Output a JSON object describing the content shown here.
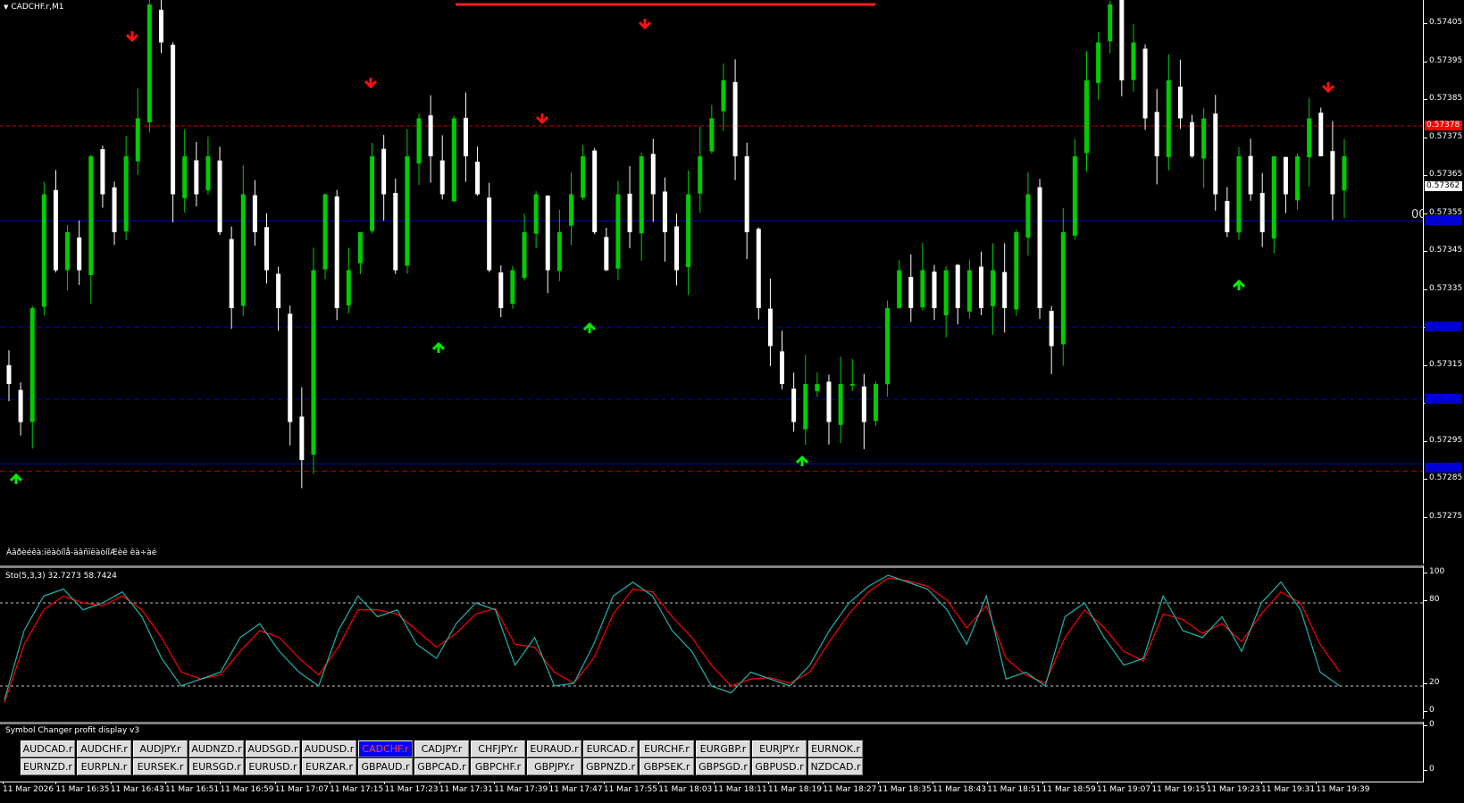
{
  "window": {
    "title": "CADCHF.r,M1"
  },
  "main": {
    "footer_note": "Àâðèéêà:ïëàòíîå-äâñïëàòíîÆèë êà÷àé",
    "spread_readout": "00"
  },
  "price_axis": {
    "ticks": [
      "0.57405",
      "0.57395",
      "0.57385",
      "0.57375",
      "0.57365",
      "0.57355",
      "0.57345",
      "0.57335",
      "0.57325",
      "0.57315",
      "0.57305",
      "0.57295",
      "0.57285",
      "0.57275"
    ],
    "tags": [
      {
        "value": "0.57378",
        "bg": "#ff0000",
        "color": "#ffffff"
      },
      {
        "value": "0.57362",
        "bg": "#ffffff",
        "color": "#000000"
      },
      {
        "value": "0.57353",
        "bg": "#0000cc",
        "color": "#0000ff"
      },
      {
        "value": "0.57325",
        "bg": "#0000cc",
        "color": "#0000ff"
      },
      {
        "value": "0.57306",
        "bg": "#0000cc",
        "color": "#0000ff"
      },
      {
        "value": "0.57288",
        "bg": "#0000cc",
        "color": "#0000ff"
      }
    ]
  },
  "colors": {
    "bull": "#00cc00",
    "bear": "#ffffff",
    "up_arrow": "#00ee00",
    "down_arrow": "#ff1010",
    "res_line": "#cc0000",
    "sup_line": "#0000cc",
    "stoch_main": "#20b2aa",
    "stoch_signal": "#ff0000",
    "ma_top": "#ff2020"
  },
  "stochastic": {
    "label": "Sto(5,3,3) 32.7273 58.7424",
    "axis_ticks": [
      "100",
      "80",
      "20",
      "0"
    ]
  },
  "symbol_panel": {
    "title": "Symbol Changer profit display v3",
    "axis_ticks": [
      "0",
      "0"
    ],
    "row1": [
      "AUDCAD.r",
      "AUDCHF.r",
      "AUDJPY.r",
      "AUDNZD.r",
      "AUDSGD.r",
      "AUDUSD.r",
      "CADCHF.r",
      "CADJPY.r",
      "CHFJPY.r",
      "EURAUD.r",
      "EURCAD.r",
      "EURCHF.r",
      "EURGBP.r",
      "EURJPY.r",
      "EURNOK.r"
    ],
    "row2": [
      "EURNZD.r",
      "EURPLN.r",
      "EURSEK.r",
      "EURSGD.r",
      "EURUSD.r",
      "EURZAR.r",
      "GBPAUD.r",
      "GBPCAD.r",
      "GBPCHF.r",
      "GBPJPY.r",
      "GBPNZD.r",
      "GBPSEK.r",
      "GBPSGD.r",
      "GBPUSD.r",
      "NZDCAD.r"
    ],
    "active": "CADCHF.r"
  },
  "time_axis": [
    "11 Mar 2026",
    "11 Mar 16:35",
    "11 Mar 16:43",
    "11 Mar 16:51",
    "11 Mar 16:59",
    "11 Mar 17:07",
    "11 Mar 17:15",
    "11 Mar 17:23",
    "11 Mar 17:31",
    "11 Mar 17:39",
    "11 Mar 17:47",
    "11 Mar 17:55",
    "11 Mar 18:03",
    "11 Mar 18:11",
    "11 Mar 18:19",
    "11 Mar 18:27",
    "11 Mar 18:35",
    "11 Mar 18:43",
    "11 Mar 18:51",
    "11 Mar 18:59",
    "11 Mar 19:07",
    "11 Mar 19:15",
    "11 Mar 19:23",
    "11 Mar 19:31",
    "11 Mar 19:39"
  ],
  "chart_data": {
    "type": "candlestick",
    "symbol": "CADCHF.r",
    "timeframe": "M1",
    "ylim": [
      0.5727,
      0.5741
    ],
    "closes": [
      0.5731,
      0.573,
      0.5733,
      0.5736,
      0.5734,
      0.5735,
      0.5734,
      0.5737,
      0.5736,
      0.5735,
      0.5737,
      0.5738,
      0.5741,
      0.574,
      0.5736,
      0.5737,
      0.5736,
      0.5737,
      0.5735,
      0.5733,
      0.5736,
      0.5735,
      0.5734,
      0.5733,
      0.573,
      0.5729,
      0.5734,
      0.5736,
      0.5733,
      0.5734,
      0.5735,
      0.5737,
      0.5736,
      0.5734,
      0.5737,
      0.5738,
      0.5737,
      0.5736,
      0.5738,
      0.5737,
      0.5736,
      0.5734,
      0.5733,
      0.5734,
      0.5735,
      0.5736,
      0.5734,
      0.5735,
      0.5736,
      0.5737,
      0.5735,
      0.5734,
      0.5736,
      0.5735,
      0.5737,
      0.5736,
      0.5735,
      0.5734,
      0.5736,
      0.5737,
      0.5738,
      0.5739,
      0.5737,
      0.5735,
      0.5733,
      0.5732,
      0.5731,
      0.573,
      0.5731,
      0.5731,
      0.573,
      0.5731,
      0.5731,
      0.573,
      0.5731,
      0.5733,
      0.5734,
      0.5733,
      0.5734,
      0.5733,
      0.5734,
      0.5733,
      0.5734,
      0.5733,
      0.5734,
      0.5733,
      0.5735,
      0.5736,
      0.5733,
      0.5732,
      0.5735,
      0.5737,
      0.5739,
      0.574,
      0.5741,
      0.5739,
      0.574,
      0.5738,
      0.5737,
      0.5739,
      0.5738,
      0.5737,
      0.5738,
      0.5736,
      0.5735,
      0.5737,
      0.5736,
      0.5735,
      0.5737,
      0.5736,
      0.5737,
      0.5738,
      0.5737,
      0.5736,
      0.5737
    ],
    "stoch_main": [
      10,
      60,
      85,
      90,
      75,
      80,
      88,
      70,
      40,
      20,
      25,
      30,
      55,
      65,
      45,
      30,
      20,
      60,
      85,
      70,
      75,
      50,
      40,
      65,
      80,
      75,
      35,
      55,
      20,
      22,
      50,
      85,
      95,
      85,
      60,
      45,
      20,
      15,
      30,
      25,
      20,
      35,
      60,
      80,
      92,
      100,
      95,
      90,
      75,
      50,
      85,
      25,
      30,
      20,
      70,
      80,
      55,
      35,
      40,
      85,
      60,
      55,
      70,
      45,
      80,
      95,
      75,
      30,
      20
    ],
    "stoch_signal": [
      8,
      50,
      75,
      85,
      80,
      78,
      85,
      75,
      55,
      30,
      25,
      28,
      45,
      60,
      55,
      40,
      28,
      48,
      75,
      75,
      72,
      60,
      48,
      58,
      72,
      76,
      50,
      48,
      30,
      22,
      40,
      72,
      90,
      88,
      70,
      55,
      35,
      20,
      25,
      26,
      22,
      30,
      52,
      72,
      88,
      98,
      96,
      92,
      82,
      62,
      78,
      40,
      28,
      22,
      55,
      75,
      62,
      45,
      38,
      72,
      68,
      58,
      65,
      52,
      72,
      88,
      80,
      50,
      30
    ]
  }
}
